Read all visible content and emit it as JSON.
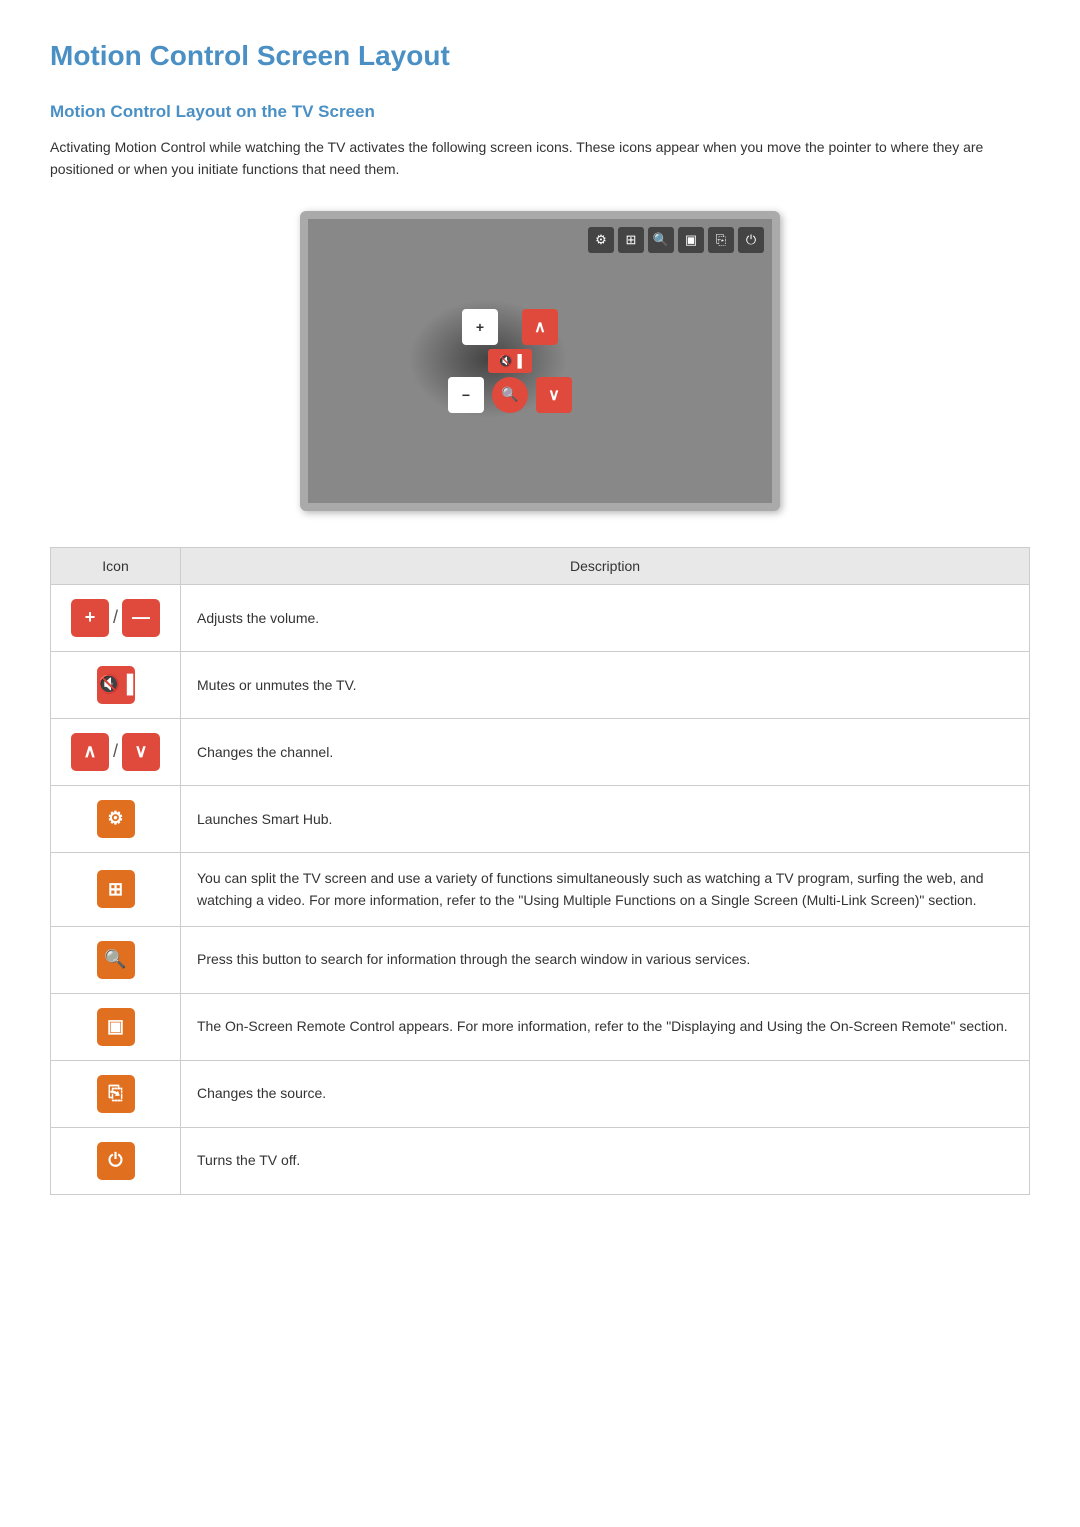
{
  "page": {
    "title": "Motion Control Screen Layout",
    "section_title": "Motion Control Layout on the TV Screen",
    "intro": "Activating Motion Control while watching the TV activates the following screen icons. These icons appear when you move the pointer to where they are positioned or when you initiate functions that need them."
  },
  "table": {
    "col_icon": "Icon",
    "col_desc": "Description",
    "rows": [
      {
        "icon_label": "+ / —",
        "icon_type": "volume",
        "description": "Adjusts the volume."
      },
      {
        "icon_label": "🔇",
        "icon_type": "mute",
        "description": "Mutes or unmutes the TV."
      },
      {
        "icon_label": "∧ / ∨",
        "icon_type": "channel",
        "description": "Changes the channel."
      },
      {
        "icon_label": "⚙",
        "icon_type": "smarthub",
        "description": "Launches Smart Hub."
      },
      {
        "icon_label": "⊞",
        "icon_type": "multilink",
        "description": "You can split the TV screen and use a variety of functions simultaneously such as watching a TV program, surfing the web, and watching a video. For more information, refer to the \"Using Multiple Functions on a Single Screen (Multi-Link Screen)\" section."
      },
      {
        "icon_label": "🔍",
        "icon_type": "search",
        "description": "Press this button to search for information through the search window in various services."
      },
      {
        "icon_label": "⬛",
        "icon_type": "onscreen-remote",
        "description": "The On-Screen Remote Control appears. For more information, refer to the \"Displaying and Using the On-Screen Remote\" section."
      },
      {
        "icon_label": "⎘",
        "icon_type": "source",
        "description": "Changes the source."
      },
      {
        "icon_label": "⏻",
        "icon_type": "power",
        "description": "Turns the TV off."
      }
    ]
  }
}
